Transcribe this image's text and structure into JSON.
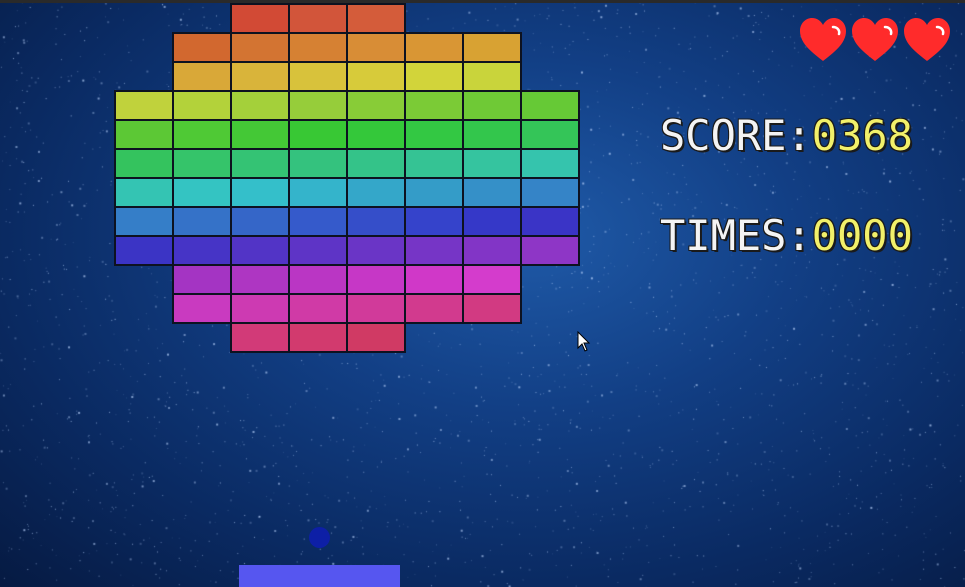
{
  "hud": {
    "score_label": "SCORE:",
    "score_value": "0368",
    "times_label": "TIMES:",
    "times_value": "0000"
  },
  "lives": {
    "count": 3,
    "icon": "heart-icon",
    "color": "#ff2b2b"
  },
  "colors": {
    "background": "#123f85",
    "paddle": "#5656f0",
    "ball": "#0d1fa6",
    "score_value": "#f2f06a"
  },
  "bricks": {
    "rows": [
      {
        "cols": [
          2,
          3,
          4
        ],
        "colors": [
          "#d24a35",
          "#d2553a",
          "#d45c3a"
        ]
      },
      {
        "cols": [
          1,
          2,
          3,
          4,
          5,
          6
        ],
        "colors": [
          "#d2682f",
          "#d37432",
          "#d68133",
          "#d88d36",
          "#d99634",
          "#d8a233"
        ]
      },
      {
        "cols": [
          1,
          2,
          3,
          4,
          5,
          6
        ],
        "colors": [
          "#d9a838",
          "#d9b43a",
          "#d8c23b",
          "#d7cb3a",
          "#d2d43a",
          "#c9d43b"
        ]
      },
      {
        "cols": [
          0,
          1,
          2,
          3,
          4,
          5,
          6,
          7
        ],
        "colors": [
          "#c0d23c",
          "#b3d23a",
          "#a4d03a",
          "#96cd3a",
          "#88cc37",
          "#7bcb36",
          "#6fc936",
          "#66c936"
        ]
      },
      {
        "cols": [
          0,
          1,
          2,
          3,
          4,
          5,
          6,
          7
        ],
        "colors": [
          "#5cc835",
          "#4fc935",
          "#44c836",
          "#38c834",
          "#34c83a",
          "#33c843",
          "#33c64c",
          "#34c558"
        ]
      },
      {
        "cols": [
          0,
          1,
          2,
          3,
          4,
          5,
          6,
          7
        ],
        "colors": [
          "#34c35e",
          "#35c46a",
          "#34c374",
          "#34c27e",
          "#34c389",
          "#35c394",
          "#35c49f",
          "#35c4ad"
        ]
      },
      {
        "cols": [
          0,
          1,
          2,
          3,
          4,
          5,
          6,
          7
        ],
        "colors": [
          "#34c4b3",
          "#34c4c2",
          "#34bfca",
          "#34b4cb",
          "#34a7c9",
          "#349cc8",
          "#3590c8",
          "#3584c7"
        ]
      },
      {
        "cols": [
          0,
          1,
          2,
          3,
          4,
          5,
          6,
          7
        ],
        "colors": [
          "#357ec8",
          "#3572c8",
          "#3566c8",
          "#355acb",
          "#354ec9",
          "#3543cb",
          "#3538c8",
          "#3a34c6"
        ]
      },
      {
        "cols": [
          0,
          1,
          2,
          3,
          4,
          5,
          6,
          7
        ],
        "colors": [
          "#3b34c5",
          "#4634c6",
          "#5234c6",
          "#5e34c6",
          "#6a35c6",
          "#7635c6",
          "#8235c6",
          "#8e36c6"
        ]
      },
      {
        "cols": [
          1,
          2,
          3,
          4,
          5,
          6
        ],
        "colors": [
          "#a434c3",
          "#ae36c2",
          "#ba36c4",
          "#c637c6",
          "#d038c8",
          "#d43ccc"
        ]
      },
      {
        "cols": [
          1,
          2,
          3,
          4,
          5,
          6
        ],
        "colors": [
          "#c93ac0",
          "#cd3ab2",
          "#d03aa6",
          "#d13a9a",
          "#d23a8e",
          "#d23a82"
        ]
      },
      {
        "cols": [
          2,
          3,
          4
        ],
        "colors": [
          "#d23a78",
          "#d23a6e",
          "#d03a64"
        ]
      }
    ]
  }
}
